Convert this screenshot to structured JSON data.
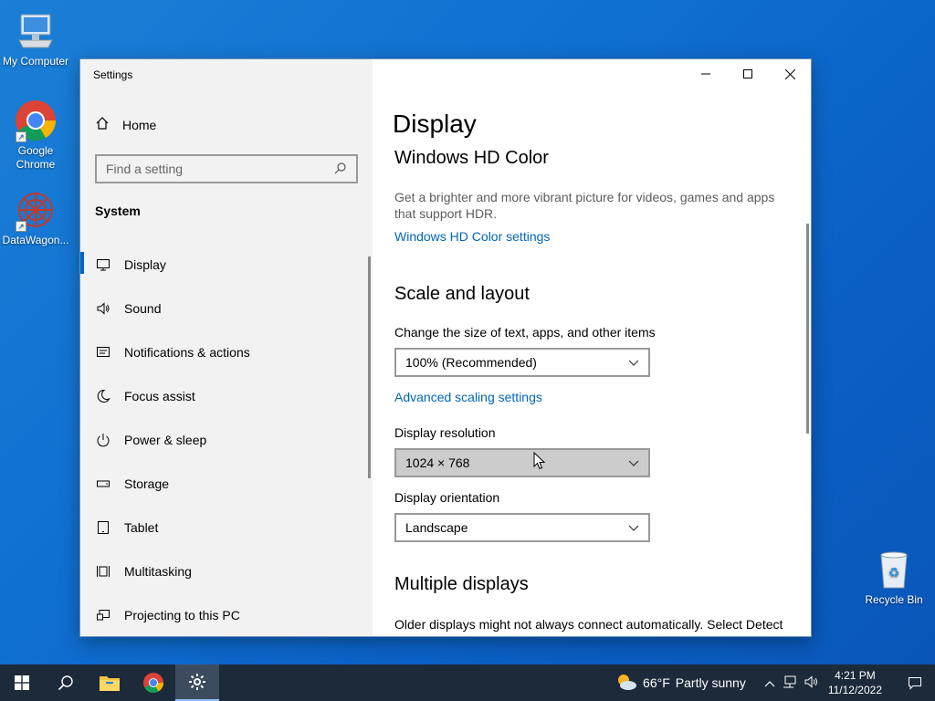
{
  "desktop": {
    "icons": [
      {
        "label": "My Computer"
      },
      {
        "label": "Google Chrome"
      },
      {
        "label": "DataWagon..."
      },
      {
        "label": "Recycle Bin"
      }
    ]
  },
  "window": {
    "title": "Settings",
    "controls": {
      "minimize": "—",
      "maximize": "☐",
      "close": "✕"
    }
  },
  "sidebar": {
    "home_label": "Home",
    "search_placeholder": "Find a setting",
    "section": "System",
    "items": [
      {
        "label": "Display",
        "icon": "monitor-icon",
        "active": true
      },
      {
        "label": "Sound",
        "icon": "speaker-icon"
      },
      {
        "label": "Notifications & actions",
        "icon": "notification-icon"
      },
      {
        "label": "Focus assist",
        "icon": "moon-icon"
      },
      {
        "label": "Power & sleep",
        "icon": "power-icon"
      },
      {
        "label": "Storage",
        "icon": "storage-icon"
      },
      {
        "label": "Tablet",
        "icon": "tablet-icon"
      },
      {
        "label": "Multitasking",
        "icon": "multitasking-icon"
      },
      {
        "label": "Projecting to this PC",
        "icon": "projecting-icon"
      }
    ]
  },
  "content": {
    "page_title": "Display",
    "hd_color": {
      "heading": "Windows HD Color",
      "description": "Get a brighter and more vibrant picture for videos, games and apps that support HDR.",
      "link": "Windows HD Color settings"
    },
    "scale_layout": {
      "heading": "Scale and layout",
      "size_label": "Change the size of text, apps, and other items",
      "size_value": "100% (Recommended)",
      "advanced_link": "Advanced scaling settings",
      "resolution_label": "Display resolution",
      "resolution_value": "1024 × 768",
      "orientation_label": "Display orientation",
      "orientation_value": "Landscape"
    },
    "multiple_displays": {
      "heading": "Multiple displays",
      "description": "Older displays might not always connect automatically. Select Detect"
    }
  },
  "taskbar": {
    "weather_temp": "66°F",
    "weather_text": "Partly sunny",
    "time": "4:21 PM",
    "date": "11/12/2022"
  },
  "colors": {
    "accent": "#0067c0",
    "link": "#0067b8",
    "taskbar": "#1c2a3a"
  }
}
